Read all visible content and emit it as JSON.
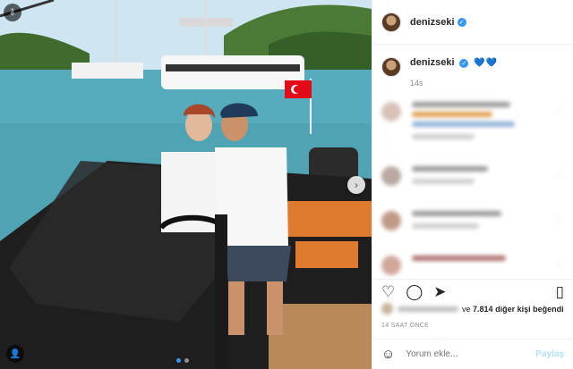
{
  "header": {
    "username": "denizseki",
    "verified_icon": "verified-badge-icon"
  },
  "caption": {
    "username": "denizseki",
    "text": "💙💙",
    "time": "14s"
  },
  "comments": [
    {
      "avatar_color": "#d8c2b8"
    },
    {
      "avatar_color": "#b9a9a0"
    },
    {
      "avatar_color": "#c09a86"
    },
    {
      "avatar_color": "#d1a79a"
    }
  ],
  "likes": {
    "connector": "ve",
    "count": "7.814",
    "suffix": "diğer kişi beğendi"
  },
  "timestamp": "14 SAAT ÖNCE",
  "comment_input": {
    "placeholder": "Yorum ekle...",
    "post_label": "Paylaş"
  },
  "carousel": {
    "slide_count": 2,
    "current_slide": 1
  },
  "colors": {
    "accent": "#3897f0",
    "post_disabled": "#b2dffc",
    "flag_red": "#e30a17"
  }
}
